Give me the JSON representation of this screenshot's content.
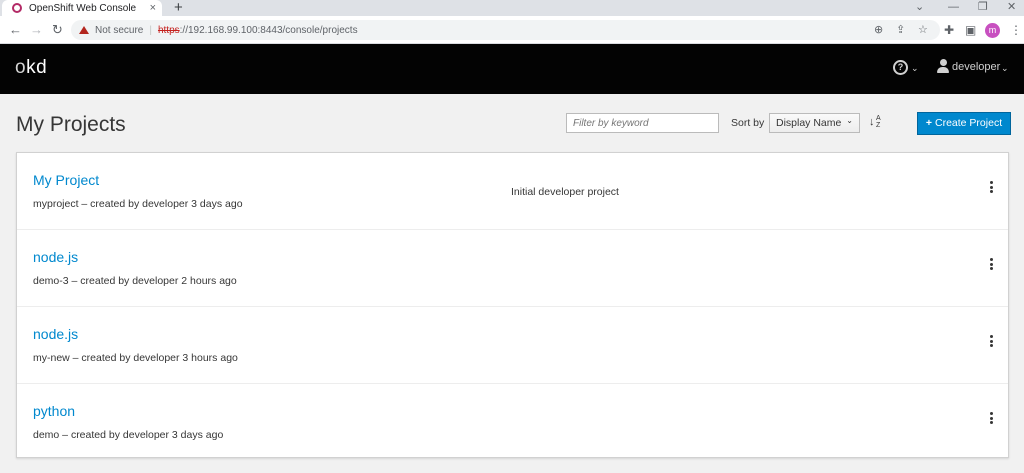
{
  "browser": {
    "tab_title": "OpenShift Web Console",
    "tab_close": "×",
    "new_tab": "+",
    "not_secure": "Not secure",
    "url_scheme": "https",
    "url_rest": "://192.168.99.100:8443/console/projects",
    "window_controls": {
      "minimize": "—",
      "maximize": "❐",
      "close": "✕",
      "chevron": "⌄"
    },
    "nav": {
      "back": "←",
      "forward": "→",
      "reload": "↻"
    },
    "profile_initial": "m"
  },
  "masthead": {
    "logo_o": "o",
    "logo_kd": "kd",
    "help": "?",
    "caret": "⌄",
    "user": "developer"
  },
  "page": {
    "title": "My Projects",
    "filter_placeholder": "Filter by keyword",
    "sort_label": "Sort by",
    "sort_value": "Display Name",
    "create_label": "Create Project"
  },
  "projects": [
    {
      "name": "My Project",
      "meta": "myproject – created by developer 3 days ago",
      "description": "Initial developer project"
    },
    {
      "name": "node.js",
      "meta": "demo-3 – created by developer 2 hours ago",
      "description": ""
    },
    {
      "name": "node.js",
      "meta": "my-new – created by developer 3 hours ago",
      "description": ""
    },
    {
      "name": "python",
      "meta": "demo – created by developer 3 days ago",
      "description": ""
    }
  ],
  "colors": {
    "masthead": "#030303",
    "link": "#0088ce",
    "primary_button": "#0088ce",
    "page_bg": "#f1f1f1"
  },
  "icons": [
    "openshift-favicon",
    "warning-icon",
    "zoom-icon",
    "share-icon",
    "star-icon",
    "extensions-icon",
    "sidepanel-icon",
    "menu-icon",
    "help-icon",
    "user-icon",
    "sort-alpha-icon",
    "plus-icon",
    "kebab-icon"
  ]
}
